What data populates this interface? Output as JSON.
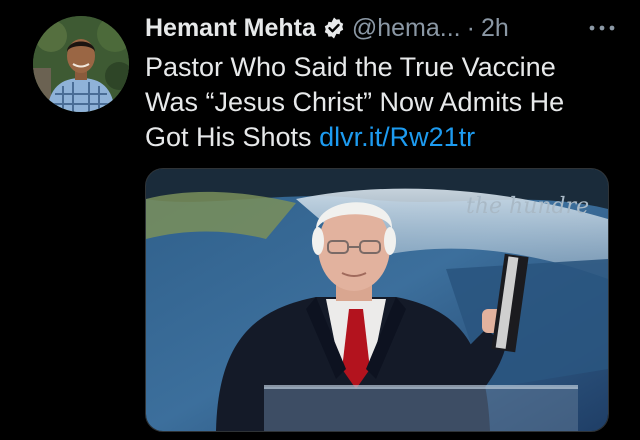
{
  "tweet": {
    "author_name": "Hemant Mehta",
    "handle": "@hema...",
    "separator": "·",
    "time": "2h",
    "text": "Pastor Who Said the True Vaccine Was “Jesus Christ” Now Admits He Got His Shots ",
    "link": "dlvr.it/Rw21tr",
    "media_watermark": "the hundre"
  },
  "icons": {
    "verified": "verified-badge-icon",
    "more": "more-options-icon"
  },
  "colors": {
    "background": "#000000",
    "text": "#e7e9ea",
    "secondary": "#8b98a5",
    "link": "#1d9bf0"
  }
}
